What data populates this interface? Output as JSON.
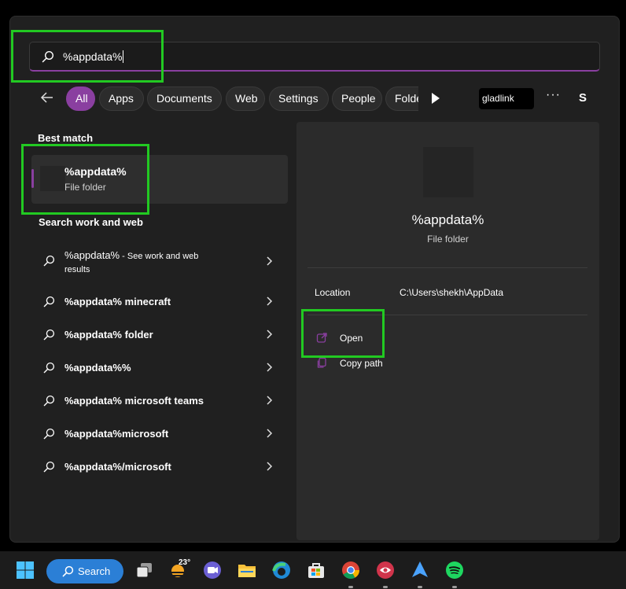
{
  "search": {
    "value": "%appdata%"
  },
  "filters": {
    "chips": [
      {
        "label": "All",
        "active": true
      },
      {
        "label": "Apps"
      },
      {
        "label": "Documents"
      },
      {
        "label": "Web"
      },
      {
        "label": "Settings"
      },
      {
        "label": "People"
      },
      {
        "label": "Folde"
      }
    ],
    "profile_label": "gladlink",
    "more": "···",
    "avatar": "S"
  },
  "best_match": {
    "title": "Best match",
    "name": "%appdata%",
    "type": "File folder"
  },
  "search_web": {
    "title": "Search work and web",
    "items": [
      {
        "bold": "%appdata%",
        "rest": " - See work and web",
        "line2": "results"
      },
      {
        "bold": "%appdata% minecraft",
        "rest": "",
        "line2": ""
      },
      {
        "bold": "%appdata% folder",
        "rest": "",
        "line2": ""
      },
      {
        "bold": "%appdata%%",
        "rest": "",
        "line2": ""
      },
      {
        "bold": "%appdata% microsoft teams",
        "rest": "",
        "line2": ""
      },
      {
        "bold": "%appdata%microsoft",
        "rest": "",
        "line2": ""
      },
      {
        "bold": "%appdata%/microsoft",
        "rest": "",
        "line2": ""
      }
    ]
  },
  "detail": {
    "name": "%appdata%",
    "type": "File folder",
    "location_label": "Location",
    "location_value": "C:\\Users\\shekh\\AppData",
    "actions": [
      {
        "label": "Open",
        "icon": "open-icon"
      },
      {
        "label": "Copy path",
        "icon": "copy-path-icon"
      }
    ]
  },
  "taskbar": {
    "search_label": "Search",
    "weather_temp": "23°",
    "apps": [
      "start-icon",
      "task-view-icon",
      "weather-icon",
      "teams-chat-icon",
      "file-explorer-icon",
      "edge-icon",
      "store-icon",
      "chrome-icon",
      "app-icon",
      "arc-icon",
      "spotify-icon"
    ]
  },
  "colors": {
    "accent": "#8a3fa0",
    "highlight": "#22c922",
    "panel": "#202020",
    "taskbar_search": "#2b7fd6"
  }
}
